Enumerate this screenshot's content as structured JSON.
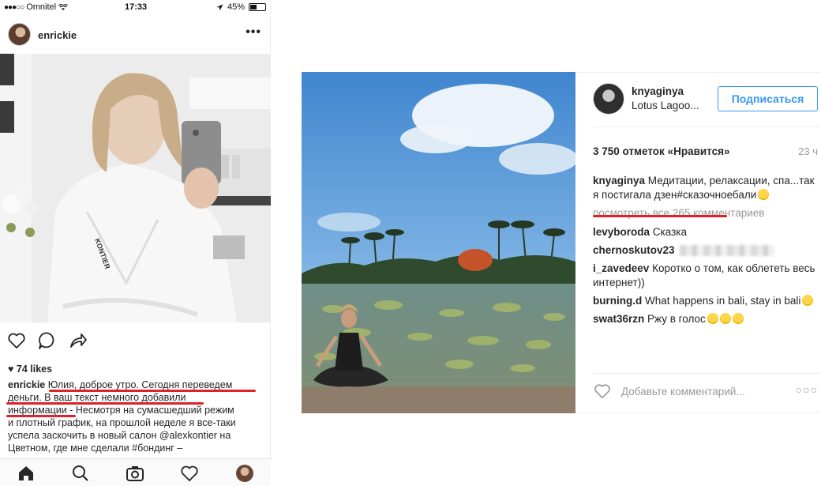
{
  "colors": {
    "accent": "#3897f0",
    "underline": "#e0202a",
    "text": "#262626",
    "muted": "#999999"
  },
  "phone": {
    "status": {
      "carrier": "Omnitel",
      "time": "17:33",
      "battery": "45%"
    },
    "post": {
      "username": "enrickie",
      "likes": "74 likes",
      "caption_username": "enrickie",
      "caption_lines": [
        "Юлия, доброе утро. Сегодня переведем",
        "деньги. В ваш текст немного добавили",
        "информации - Несмотря на сумасшедший режим",
        "и плотный график, на прошлой неделе я все-таки",
        "успела заскочить в новый салон @alexkontier на",
        "Цветном, где мне сделали #бондинг –"
      ]
    },
    "icons": {
      "more": "more-options-icon",
      "actions": [
        "heart-icon",
        "comment-icon",
        "share-icon"
      ],
      "tabbar": [
        "home-icon",
        "search-icon",
        "camera-icon",
        "activity-heart-icon",
        "profile-avatar-icon"
      ]
    }
  },
  "desktop": {
    "post": {
      "username": "knyaginya",
      "location": "Lotus Lagoo...",
      "follow_label": "Подписаться",
      "likes": "3 750 отметок «Нравится»",
      "time": "23 ч",
      "caption": {
        "username": "knyaginya",
        "text": "Медитации, релаксации, спа...так я постигала дзен",
        "hashtag": "#сказочноебали"
      },
      "view_more": "посмотреть все 265 комментариев",
      "comments": [
        {
          "username": "levyboroda",
          "text": "Сказка"
        },
        {
          "username": "chernoskutov23",
          "text": ""
        },
        {
          "username": "i_zavedeev",
          "text": "Коротко о том, как облететь весь интернет))"
        },
        {
          "username": "burning.d",
          "text": "What happens in bali, stay in bali"
        },
        {
          "username": "swat36rzn",
          "text": "Ржу в голос"
        }
      ],
      "add_comment_placeholder": "Добавьте комментарий...",
      "options": "..."
    }
  }
}
